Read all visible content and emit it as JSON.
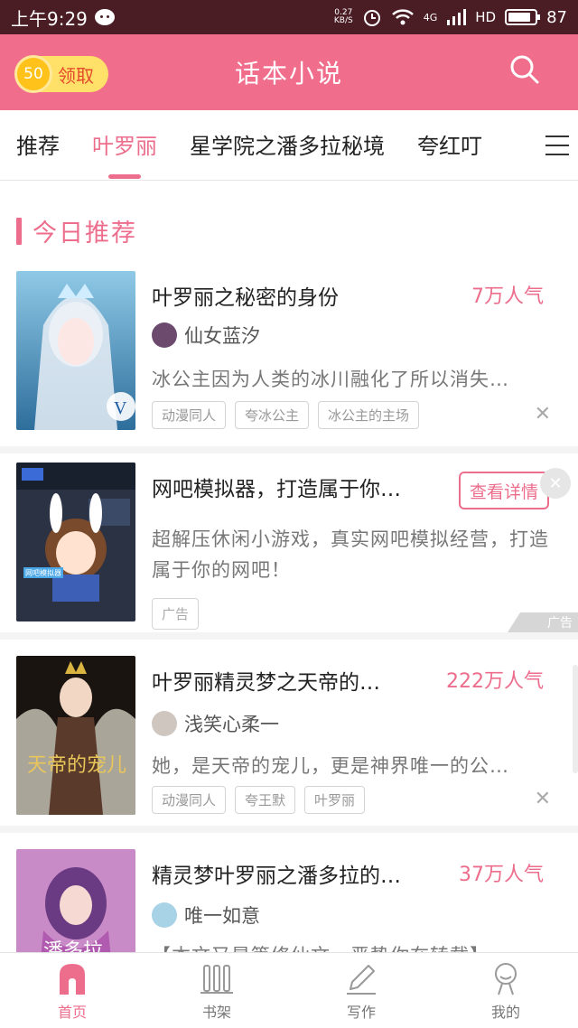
{
  "status_bar": {
    "time": "上午9:29",
    "net_speed_value": "0.27",
    "net_speed_unit": "KB/S",
    "network": "4G",
    "hd": "HD",
    "battery": "87"
  },
  "header": {
    "title": "话本小说",
    "coin_count": "50",
    "coin_label": "领取"
  },
  "tabs": [
    {
      "label": "推荐",
      "active": false
    },
    {
      "label": "叶罗丽",
      "active": true
    },
    {
      "label": "星学院之潘多拉秘境",
      "active": false
    },
    {
      "label": "夸红叮",
      "active": false
    }
  ],
  "section": {
    "title": "今日推荐"
  },
  "cards": [
    {
      "title": "叶罗丽之秘密的身份",
      "popularity": "7万人气",
      "author": "仙女蓝汐",
      "desc": "冰公主因为人类的冰川融化了所以消失…",
      "tags": [
        "动漫同人",
        "夸冰公主",
        "冰公主的主场"
      ]
    },
    {
      "title": "叶罗丽精灵梦之天帝的…",
      "popularity": "222万人气",
      "author": "浅笑心柔一",
      "desc": "她，是天帝的宠儿，更是神界唯一的公…",
      "tags": [
        "动漫同人",
        "夸王默",
        "叶罗丽"
      ]
    },
    {
      "title": "精灵梦叶罗丽之潘多拉的…",
      "popularity": "37万人气",
      "author": "唯一如意",
      "desc": "【本文又是篇修仙文，恶势你在转载】",
      "tags": []
    }
  ],
  "ad": {
    "title": "网吧模拟器，打造属于你…",
    "button": "查看详情",
    "desc": "超解压休闲小游戏，真实网吧模拟经营，打造属于你的网吧！",
    "badge": "广告",
    "corner": "广告"
  },
  "covers": {
    "book1_text": "V",
    "ad_text": "网吧模拟器",
    "book2_text": "天帝的宠儿",
    "book3_text": "潘多拉"
  },
  "bottom_nav": [
    {
      "label": "首页",
      "icon": "home-icon",
      "active": true
    },
    {
      "label": "书架",
      "icon": "bookshelf-icon",
      "active": false
    },
    {
      "label": "写作",
      "icon": "pen-icon",
      "active": false
    },
    {
      "label": "我的",
      "icon": "profile-icon",
      "active": false
    }
  ],
  "colors": {
    "accent": "#ec6e8c",
    "header_bg": "#f06e8c",
    "coin_btn": "#ffe16a"
  }
}
